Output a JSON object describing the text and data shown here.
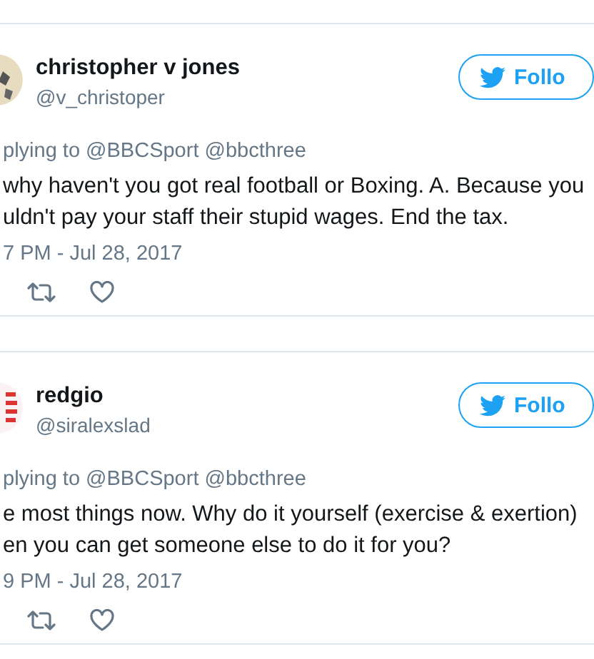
{
  "tweets": [
    {
      "name": "christopher v jones",
      "handle": "@v_christoper",
      "follow": {
        "label": "Follo"
      },
      "replying_to": "plying to @BBCSport @bbcthree",
      "text": "why haven't you got real football or Boxing. A. Because you\nuldn't pay your staff their stupid wages. End the tax.",
      "time": "7 PM - Jul 28, 2017"
    },
    {
      "name": "redgio",
      "handle": "@siralexslad",
      "follow": {
        "label": "Follo"
      },
      "replying_to": "plying to @BBCSport @bbcthree",
      "text": "e most things now. Why do it yourself (exercise & exertion)\nen you can get someone else to do it for you?",
      "time": "9 PM - Jul 28, 2017"
    }
  ]
}
